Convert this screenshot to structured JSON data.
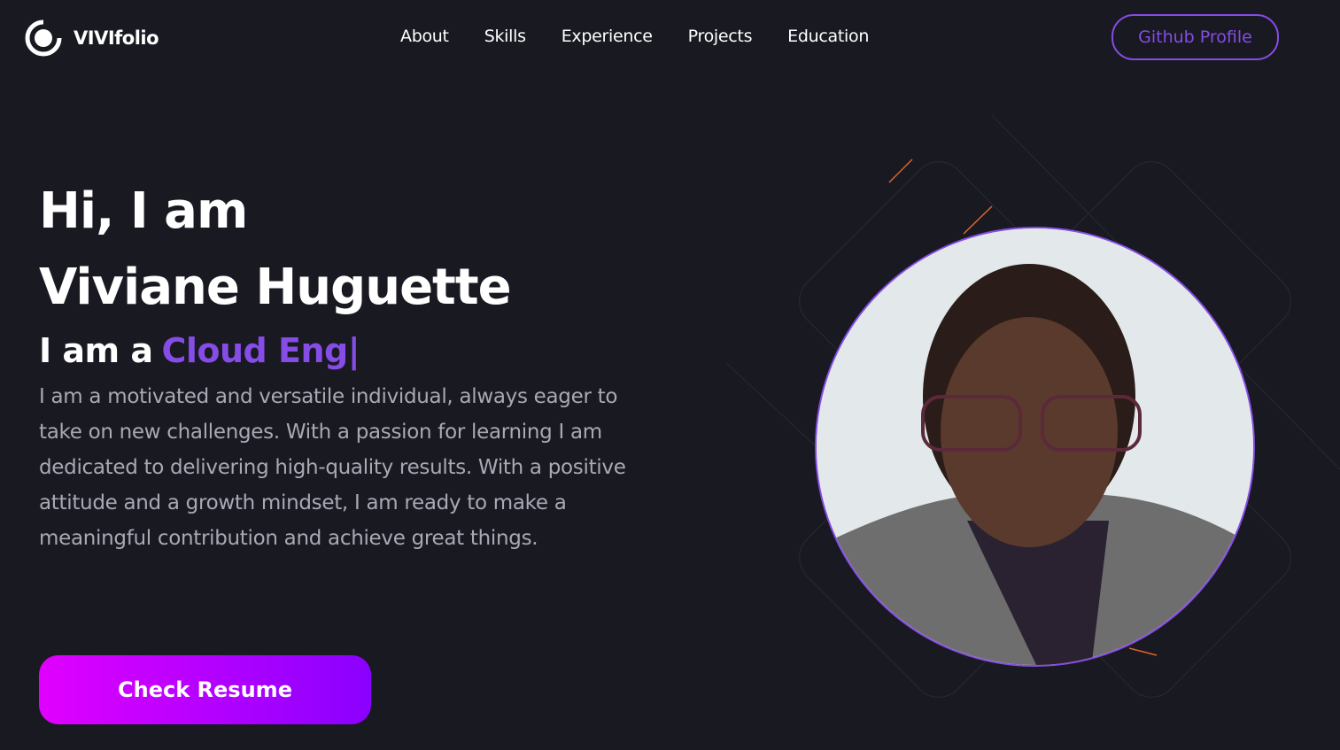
{
  "brand": {
    "name": "VIVIfolio",
    "icon": "ring-logo-icon"
  },
  "nav": {
    "links": [
      "About",
      "Skills",
      "Experience",
      "Projects",
      "Education"
    ],
    "github_label": "Github Profile"
  },
  "hero": {
    "line1": "Hi, I am",
    "name": "Viviane Huguette",
    "role_prefix": "I am a",
    "role_typed": "Cloud Eng|",
    "description": "I am a motivated and versatile individual, always eager to take on new challenges. With a passion for learning I am dedicated to delivering high-quality results. With a positive attitude and a growth mindset, I am ready to make a meaningful contribution and achieve great things.",
    "resume_label": "Check Resume"
  },
  "colors": {
    "background": "#191922",
    "accent": "#854ce6",
    "button_start": "#e100ff",
    "button_end": "#8a00ff",
    "description": "#a9a9b5"
  }
}
